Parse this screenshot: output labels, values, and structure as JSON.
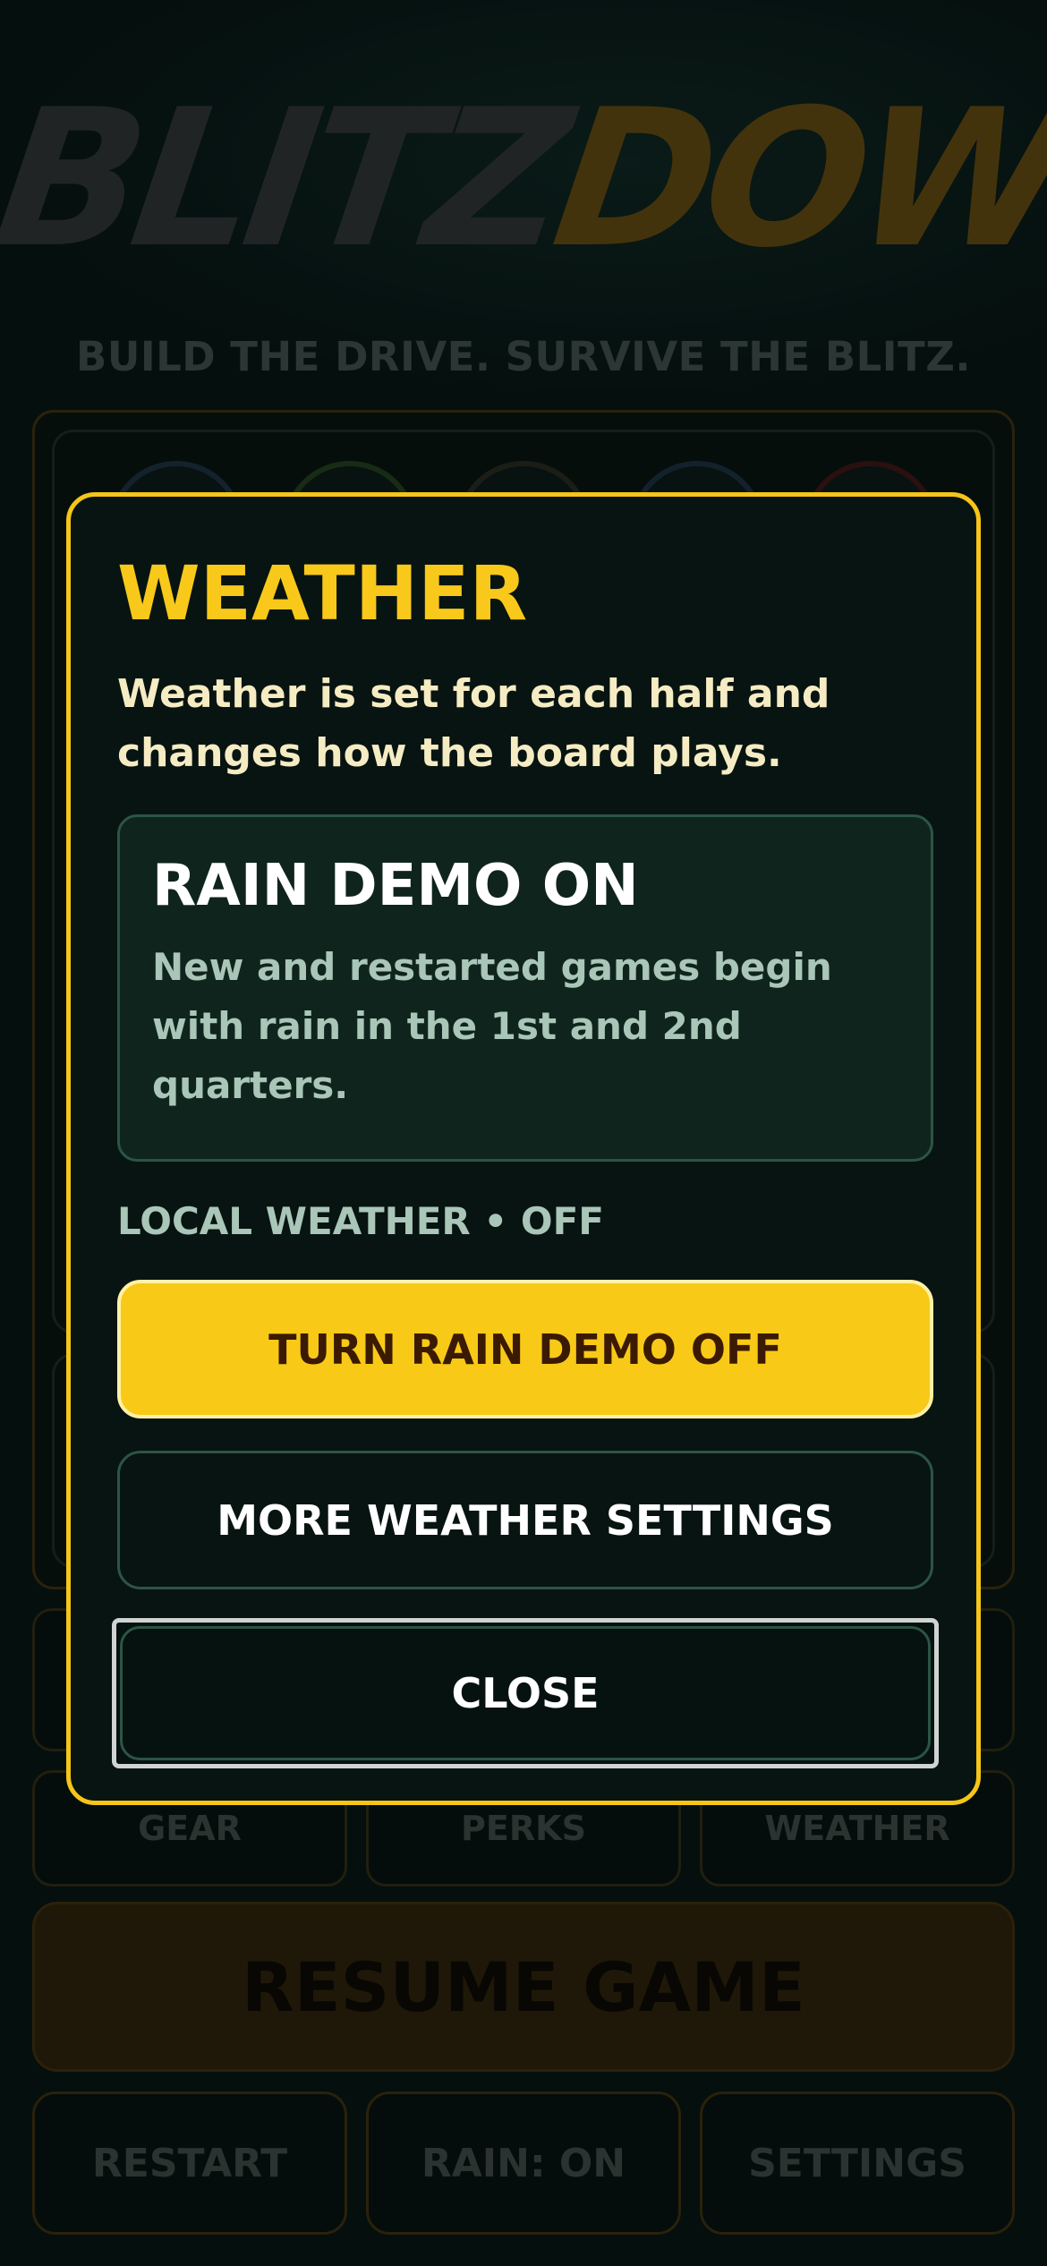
{
  "background": {
    "logo": {
      "part1": "BLITZ",
      "part2": "DOWN"
    },
    "tagline": "BUILD THE DRIVE. SURVIVE THE BLITZ.",
    "tabs": [
      "GEAR",
      "PERKS",
      "WEATHER"
    ],
    "resume_label": "RESUME GAME",
    "bottom_buttons": [
      "RESTART",
      "RAIN: ON",
      "SETTINGS"
    ]
  },
  "modal": {
    "title": "WEATHER",
    "description": "Weather is set for each half and changes how the board plays.",
    "card": {
      "title": "RAIN DEMO ON",
      "description": "New and restarted games begin with rain in the 1st and 2nd quarters."
    },
    "status": "LOCAL WEATHER • OFF",
    "primary_button": "TURN RAIN DEMO OFF",
    "secondary_button": "MORE WEATHER SETTINGS",
    "close_button": "CLOSE"
  },
  "colors": {
    "accent": "#f8ca17",
    "background": "#071513",
    "card": "#10241e"
  }
}
